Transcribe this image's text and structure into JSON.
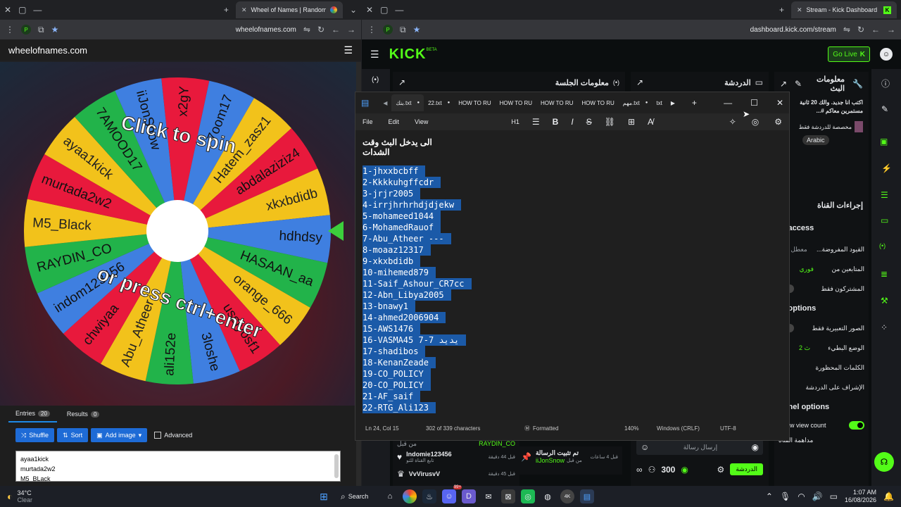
{
  "left_browser": {
    "tab_title": "Wheel of Names | Random nam",
    "url": "wheelofnames.com",
    "profile": "P"
  },
  "wheel_site": {
    "brand": "wheelofnames.com",
    "click_text": "Click to spin",
    "press_text": "or press ctrl+enter",
    "segments": [
      "x2gY",
      "7oom17",
      "Hatem_zasz1",
      "abdalaziziz4",
      "xkxbdidb",
      "hdhdsy",
      "HASAAN_aa",
      "orange_666",
      "ussfyosf1",
      "3loshe",
      "ali152e",
      "Abu_Atheer",
      "chwiyaa",
      "indom123456",
      "RAYDIN_CO",
      "M5_Black",
      "murtada2w2",
      "ayaa1kick",
      "7AMOOD17",
      "iiJonSnow"
    ],
    "tabs": {
      "entries_label": "Entries",
      "entries_count": "20",
      "results_label": "Results",
      "results_count": "0"
    },
    "buttons": {
      "shuffle": "Shuffle",
      "sort": "Sort",
      "add_image": "Add image",
      "advanced": "Advanced"
    },
    "entries_preview": [
      "ayaa1kick",
      "murtada2w2",
      "M5_BLack"
    ]
  },
  "right_browser": {
    "tab_title": "Stream - Kick Dashboard",
    "url": "dashboard.kick.com/stream",
    "profile": "P"
  },
  "kick": {
    "logo": "KICK",
    "beta": "BETA",
    "go_live": "Go Live",
    "panel_session": "معلومات الجلسة",
    "panel_chat": "الدردشة",
    "panel_stream_info": "معلومات البث",
    "stream_title": "اكتب انا جديد. والك 20 ثانية مستمرين معاكم #...",
    "category_text": "مخصصة للدردشة فقط",
    "language": "Arabic",
    "channel_actions": "إجراءات القناة",
    "chat_access": "Chat access",
    "access_rows": [
      {
        "label": "...القيود المفروضة",
        "value": "معطل"
      },
      {
        "label": "المتابعين من",
        "value": "فوري"
      },
      {
        "label": "المشتركون فقط",
        "value": ""
      }
    ],
    "chat_options": "Chat options",
    "option_rows": [
      {
        "label": "الصور التعبيرية فقط",
        "value": ""
      },
      {
        "label": "الوضع البطيء",
        "value": "2 ث"
      },
      {
        "label": "الكلمات المحظورة",
        "value": ""
      },
      {
        "label": "الإشراف على الدردشة",
        "value": ""
      }
    ],
    "channel_options": "Channel options",
    "show_view_count": "Show view count",
    "channel_views": "مداهمة القناة",
    "chat_feed": [
      {
        "name": "RAYDIN_CO",
        "meta": "من قبل"
      },
      {
        "name": "Indomie123456",
        "meta": "تابع القناة للتو",
        "time": "قبل 44 دقيقة"
      },
      {
        "name": "VvVirusvV",
        "meta": "",
        "time": "قبل 45 دقيقة"
      }
    ],
    "pinned": {
      "title": "تم تثبيت الرسالة",
      "by": "iiJonSnow",
      "prefix": "من قبل",
      "time": "قبل 4 ساعات"
    },
    "chat_input_placeholder": "إرسال رسالة",
    "points": "300",
    "chat_button": "الدردشة"
  },
  "notepad": {
    "tabs": [
      {
        "label": "بنك.txt",
        "active": true
      },
      {
        "label": "22.txt",
        "active": false
      },
      {
        "label": "HOW TO RU",
        "active": false
      },
      {
        "label": "HOW TO RU",
        "active": false
      },
      {
        "label": "HOW TO RU",
        "active": false
      },
      {
        "label": "HOW TO RU",
        "active": false
      },
      {
        "label": "مهم.txt",
        "active": false
      },
      {
        "label": "txt",
        "active": false
      }
    ],
    "menu": {
      "file": "File",
      "edit": "Edit",
      "view": "View",
      "heading": "H1"
    },
    "heading_line": "الى يدخل البث وقت الشدات",
    "lines": [
      "1-jhxxbcbff",
      "2-Kkkkuhgffcdr",
      "3-jrjr2005",
      "4-irrjhrhrhdjdjekw",
      "5-mohameed1044",
      "6-MohamedRauof",
      "7-Abu_Atheer ---",
      "8-moaaz12317",
      "9-xkxbdidb",
      "10-mihemed879",
      "11-Saif_Ashour_CR7cc",
      "12-Abn_Libya2005",
      "13-bnawy1",
      "14-ahmed2006904",
      "15-AWS1476",
      "16-VASMA45 يديد 7-7",
      "17-shadibos",
      "18-KenanZeade",
      "19-CO_POLICY",
      "20-CO_POLICY",
      "21-AF_saif",
      "22-RTG_Ali123"
    ],
    "status": {
      "pos": "Ln 24, Col 15",
      "chars": "302 of 339 characters",
      "format": "Formatted",
      "zoom": "140%",
      "eol": "Windows (CRLF)",
      "enc": "UTF-8"
    }
  },
  "taskbar": {
    "weather_temp": "34°C",
    "weather_text": "Clear",
    "search": "Search",
    "time": "1:07 AM",
    "date": "16/08/2026",
    "badge": "99+"
  },
  "colors": {
    "kick_green": "#53fc18",
    "selection": "#1b5aa8",
    "wheel_blue": "#1e6bd6"
  }
}
